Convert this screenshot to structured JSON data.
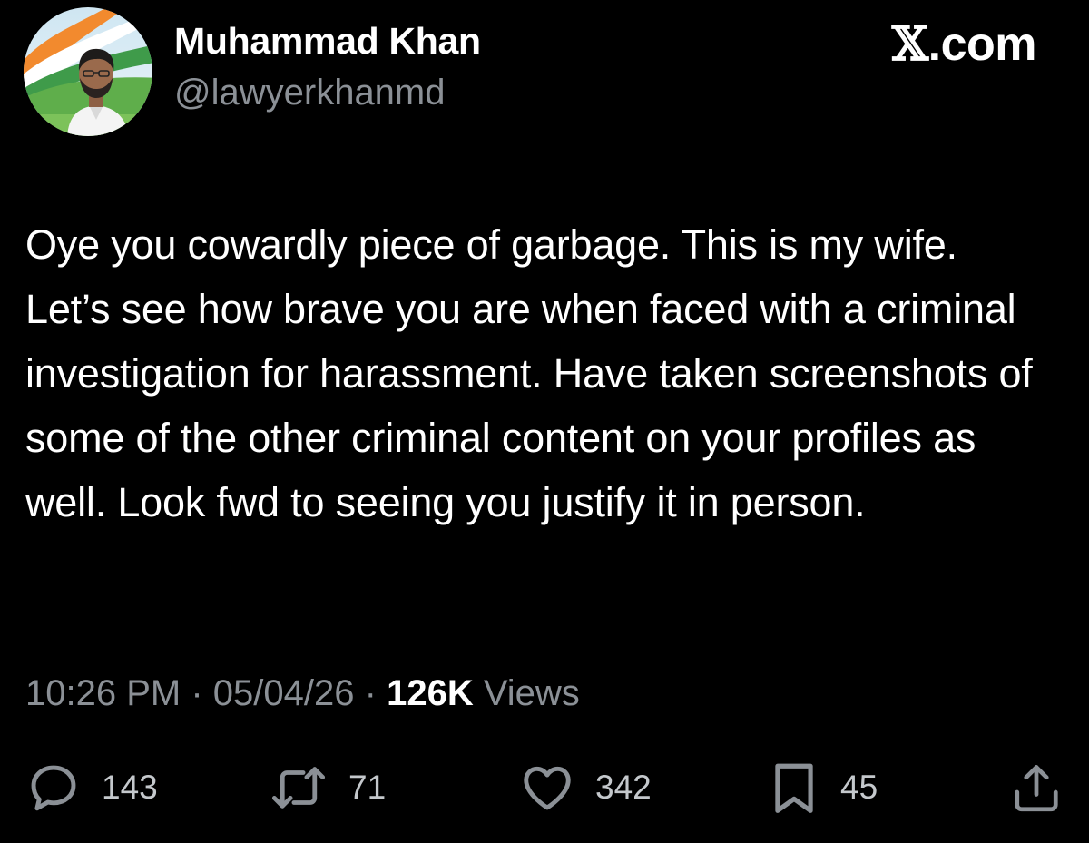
{
  "site": {
    "x_letter": "𝕏",
    "domain": ".com"
  },
  "author": {
    "name": "Muhammad Khan",
    "handle": "@lawyerkhanmd",
    "avatar_icon": "profile-photo-icon"
  },
  "post": {
    "text": "Oye you cowardly piece of garbage. This is my wife. Let’s see how brave you are when faced with a criminal investigation for harassment. Have taken screenshots of some of the other criminal content on your profiles as well. Look fwd to seeing you justify it in person.",
    "time": "10:26 PM",
    "date": "05/04/26",
    "separator": "·",
    "views_count": "126K",
    "views_label": "Views"
  },
  "actions": {
    "reply": {
      "icon": "reply-icon",
      "count": "143"
    },
    "repost": {
      "icon": "repost-icon",
      "count": "71"
    },
    "like": {
      "icon": "heart-icon",
      "count": "342"
    },
    "bookmark": {
      "icon": "bookmark-icon",
      "count": "45"
    },
    "share": {
      "icon": "share-icon"
    }
  },
  "colors": {
    "background": "#000000",
    "primary_text": "#ffffff",
    "secondary_text": "#8b9096"
  }
}
